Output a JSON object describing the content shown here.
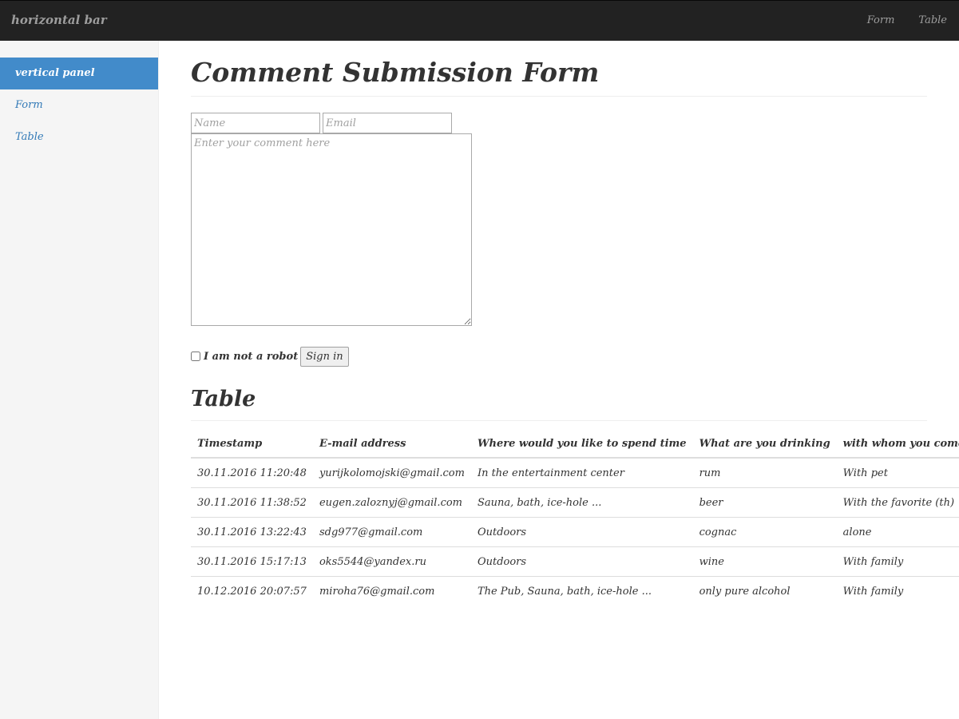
{
  "navbar": {
    "brand": "horizontal bar",
    "links": [
      "Form",
      "Table"
    ]
  },
  "sidebar": {
    "items": [
      {
        "label": "vertical panel",
        "active": true
      },
      {
        "label": "Form",
        "active": false
      },
      {
        "label": "Table",
        "active": false
      }
    ]
  },
  "form": {
    "title": "Comment Submission Form",
    "name_placeholder": "Name",
    "email_placeholder": "Email",
    "comment_placeholder": "Enter your comment here",
    "robot_label": "I am not a robot",
    "submit_label": "Sign in"
  },
  "table": {
    "title": "Table",
    "headers": [
      "Timestamp",
      "E-mail address",
      "Where would you like to spend time",
      "What are you drinking",
      "with whom you come?"
    ],
    "rows": [
      [
        "30.11.2016 11:20:48",
        "yurijkolomojski@gmail.com",
        "In the entertainment center",
        "rum",
        "With pet"
      ],
      [
        "30.11.2016 11:38:52",
        "eugen.zaloznyj@gmail.com",
        "Sauna, bath, ice-hole ...",
        "beer",
        "With the favorite (th)"
      ],
      [
        "30.11.2016 13:22:43",
        "sdg977@gmail.com",
        "Outdoors",
        "cognac",
        "alone"
      ],
      [
        "30.11.2016 15:17:13",
        "oks5544@yandex.ru",
        "Outdoors",
        "wine",
        "With family"
      ],
      [
        "10.12.2016 20:07:57",
        "miroha76@gmail.com",
        "The Pub, Sauna, bath, ice-hole ...",
        "only pure alcohol",
        "With family"
      ]
    ]
  },
  "colors": {
    "navbar_bg": "#222222",
    "navbar_text": "#9d9d9d",
    "sidebar_bg": "#f5f5f5",
    "active_bg": "#428bca",
    "link": "#337ab7"
  }
}
